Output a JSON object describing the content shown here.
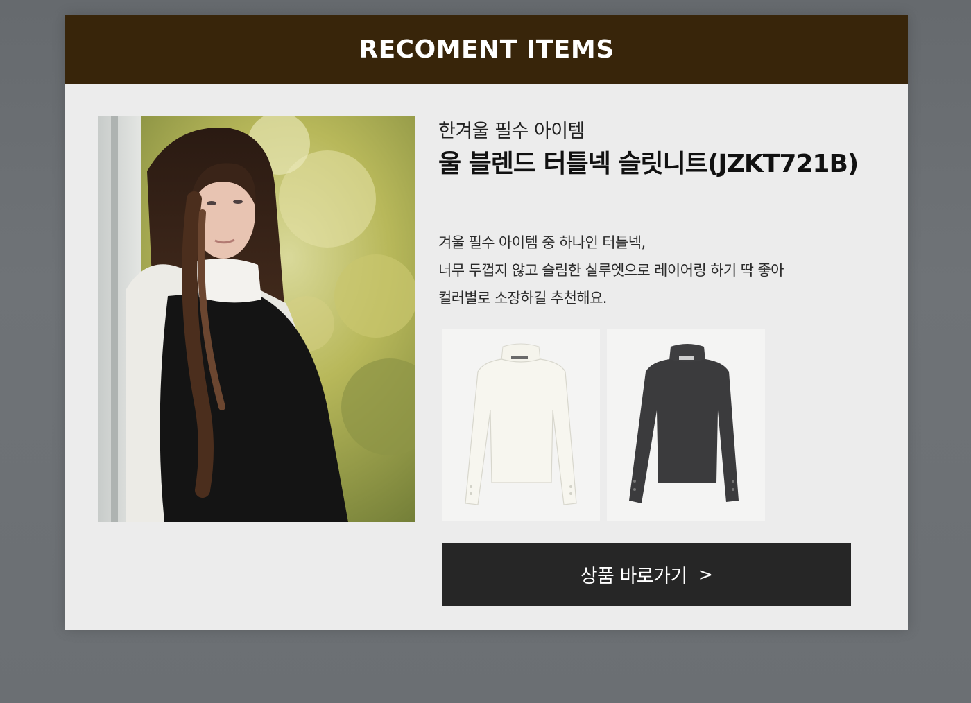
{
  "header": {
    "title": "RECOMENT ITEMS"
  },
  "product": {
    "subtitle": "한겨울 필수 아이템",
    "name": "울 블렌드 터틀넥 슬릿니트(JZKT721B)",
    "description": [
      "겨울 필수 아이템 중 하나인 터틀넥,",
      "너무 두껍지 않고 슬림한 실루엣으로 레이어링 하기 딱 좋아",
      "컬러별로 소장하길 추천해요."
    ]
  },
  "cta": {
    "label": "상품 바로가기",
    "chevron": ">"
  },
  "colors": {
    "header_bg": "#38250a",
    "card_bg": "#ececec",
    "button_bg": "#262626",
    "knit_white": "#f6f5ee",
    "knit_charcoal": "#3d3d3f"
  }
}
